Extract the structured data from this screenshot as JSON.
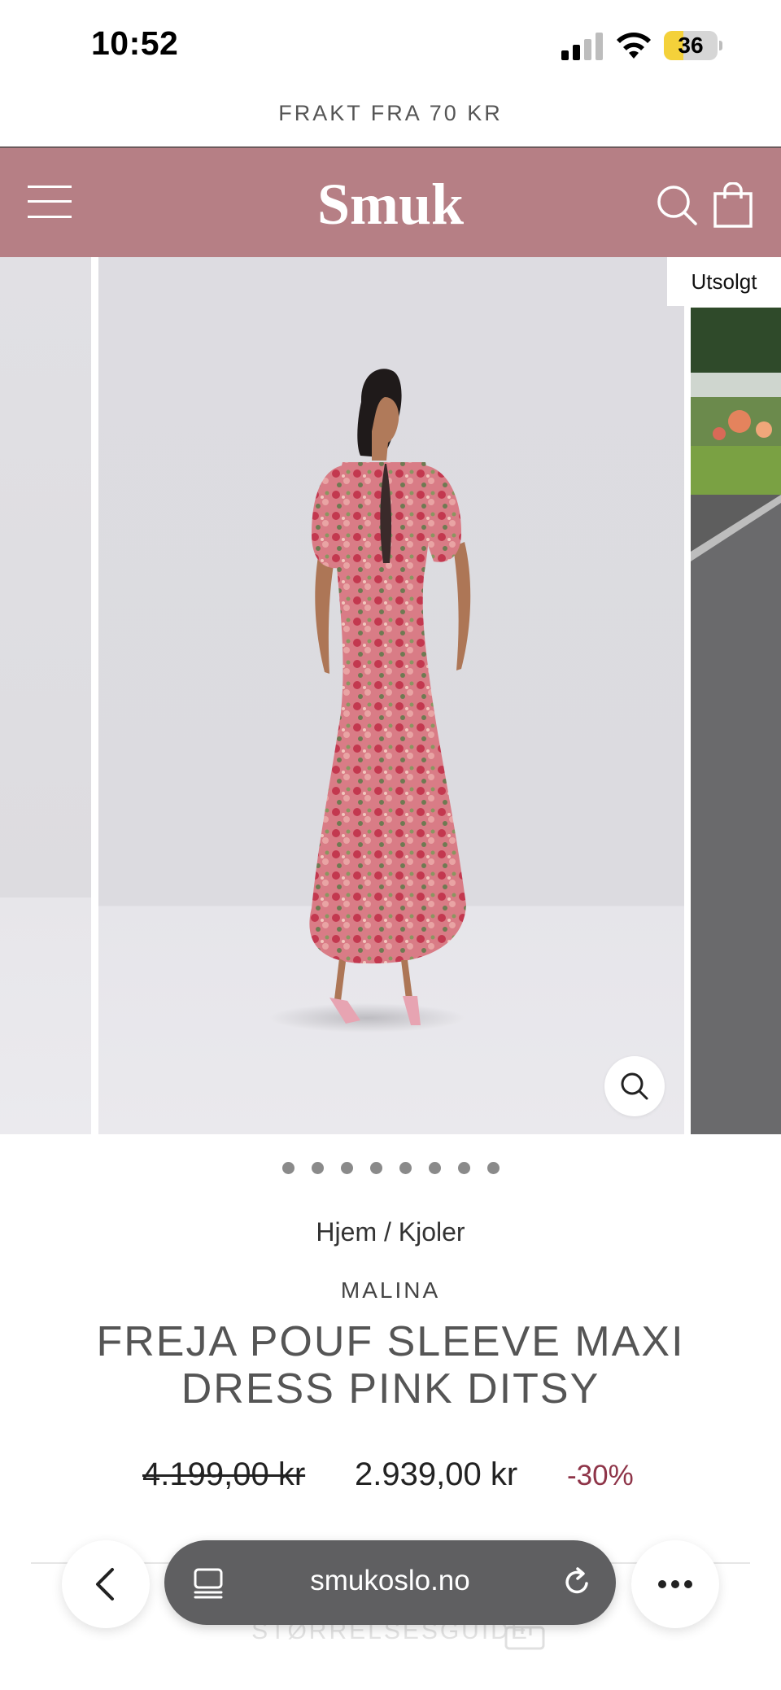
{
  "status_bar": {
    "time": "10:52",
    "battery_level": "36",
    "battery_fraction": 0.36,
    "battery_color": "#f4d13a"
  },
  "promo": {
    "text": "FRAKT FRA 70 KR"
  },
  "header": {
    "logo": "Smuk",
    "background": "#b67f85",
    "icons": [
      "hamburger-menu-icon",
      "search-icon",
      "shopping-bag-icon"
    ]
  },
  "gallery": {
    "badge": "Utsolgt",
    "slide_count": 8,
    "active_slide": 1,
    "zoom_icon": "magnifier-icon"
  },
  "breadcrumb": {
    "home": "Hjem",
    "separator": "/",
    "category": "Kjoler"
  },
  "product": {
    "brand": "MALINA",
    "title": "FREJA POUF SLEEVE MAXI DRESS PINK DITSY",
    "price_original": "4.199,00 kr",
    "price_sale": "2.939,00 kr",
    "discount": "-30%",
    "discount_color": "#8e3448"
  },
  "size_guide": {
    "label": "STØRRELSESGUIDE"
  },
  "browser": {
    "url": "smukoslo.no",
    "icons": [
      "back-chevron-icon",
      "tabs-icon",
      "reload-icon",
      "more-dots-icon"
    ]
  }
}
